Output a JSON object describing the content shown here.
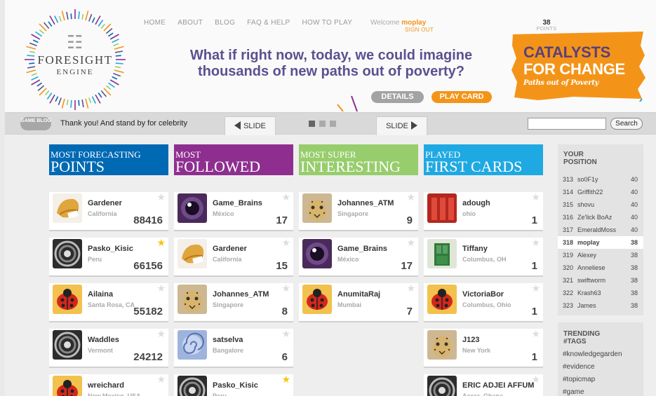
{
  "nav": {
    "items": [
      "HOME",
      "ABOUT",
      "BLOG",
      "FAQ & HELP",
      "HOW TO PLAY"
    ],
    "welcome_prefix": "Welcome",
    "username": "moplay",
    "signout": "SIGN OUT",
    "points_value": "38",
    "points_label": "POINTS"
  },
  "logo": {
    "line1": "FORESIGHT",
    "line2": "ENGINE"
  },
  "headline": {
    "line1": "What if right now, today, we could imagine",
    "line2": "thousands of new paths out of poverty?"
  },
  "banner": {
    "line1": "CATALYSTS",
    "line2": "FOR CHANGE",
    "line3": "Paths out of Poverty"
  },
  "buttons": {
    "details": "DETAILS",
    "play_card": "PLAY CARD"
  },
  "slidebar": {
    "game_blog": "GAME BLOG",
    "ticker": "Thank you! And stand by for celebrity",
    "prev": "SLIDE",
    "next": "SLIDE",
    "search_value": "",
    "search_button": "Search"
  },
  "columns": [
    {
      "title_small": "MOST FORECASTING",
      "title_big": "POINTS",
      "color": "#0069b4",
      "cards": [
        {
          "name": "Gardener",
          "loc": "California",
          "num": "88416",
          "avatar": "cookie",
          "star": false
        },
        {
          "name": "Pasko_Kisic",
          "loc": "Peru",
          "num": "66156",
          "avatar": "shell",
          "star": true
        },
        {
          "name": "Ailaina",
          "loc": "Santa Rosa, CA",
          "num": "55182",
          "avatar": "ladybug",
          "star": false
        },
        {
          "name": "Waddles",
          "loc": "Vermont",
          "num": "24212",
          "avatar": "shell",
          "star": false
        },
        {
          "name": "wreichard",
          "loc": "New Mexico, USA",
          "num": "",
          "avatar": "ladybug",
          "star": false
        }
      ]
    },
    {
      "title_small": "MOST",
      "title_big": "FOLLOWED",
      "color": "#8e2f90",
      "cards": [
        {
          "name": "Game_Brains",
          "loc": "México",
          "num": "17",
          "avatar": "eye",
          "star": false
        },
        {
          "name": "Gardener",
          "loc": "California",
          "num": "15",
          "avatar": "cookie",
          "star": false
        },
        {
          "name": "Johannes_ATM",
          "loc": "Singapore",
          "num": "8",
          "avatar": "cheetah",
          "star": false
        },
        {
          "name": "satselva",
          "loc": "Bangalore",
          "num": "6",
          "avatar": "swirl",
          "star": false
        },
        {
          "name": "Pasko_Kisic",
          "loc": "Peru",
          "num": "",
          "avatar": "shell",
          "star": true
        }
      ]
    },
    {
      "title_small": "MOST SUPER",
      "title_big": "INTERESTING",
      "color": "#97cd6c",
      "cards": [
        {
          "name": "Johannes_ATM",
          "loc": "Singapore",
          "num": "9",
          "avatar": "cheetah",
          "star": false
        },
        {
          "name": "Game_Brains",
          "loc": "México",
          "num": "17",
          "avatar": "eye",
          "star": false
        },
        {
          "name": "AnumitaRaj",
          "loc": "Mumbai",
          "num": "7",
          "avatar": "ladybug",
          "star": false
        }
      ]
    },
    {
      "title_small": "PLAYED",
      "title_big": "FIRST CARDS",
      "color": "#1fa9e2",
      "cards": [
        {
          "name": "adough",
          "loc": "ohio",
          "num": "1",
          "avatar": "redwall",
          "star": false
        },
        {
          "name": "Tiffany",
          "loc": "Columbus, OH",
          "num": "1",
          "avatar": "door",
          "star": false
        },
        {
          "name": "VictoriaBor",
          "loc": "Columbus, Ohio",
          "num": "1",
          "avatar": "ladybug",
          "star": false
        },
        {
          "name": "J123",
          "loc": "New York",
          "num": "1",
          "avatar": "cheetah",
          "star": false
        },
        {
          "name": "ERIC ADJEI AFFUM",
          "loc": "Accra, Ghana",
          "num": "",
          "avatar": "shell",
          "star": false
        }
      ]
    }
  ],
  "ranking": {
    "title_line1": "YOUR",
    "title_line2": "POSITION",
    "rows": [
      {
        "rank": "313",
        "name": "so0F1y",
        "points": "40"
      },
      {
        "rank": "314",
        "name": "Griffith22",
        "points": "40"
      },
      {
        "rank": "315",
        "name": "shovu",
        "points": "40"
      },
      {
        "rank": "316",
        "name": "Ze'lick BoAz",
        "points": "40"
      },
      {
        "rank": "317",
        "name": "EmeraldMoss",
        "points": "40"
      },
      {
        "rank": "318",
        "name": "moplay",
        "points": "38"
      },
      {
        "rank": "319",
        "name": "Alexey",
        "points": "38"
      },
      {
        "rank": "320",
        "name": "Anneliese",
        "points": "38"
      },
      {
        "rank": "321",
        "name": "swiftworm",
        "points": "38"
      },
      {
        "rank": "322",
        "name": "Krash63",
        "points": "38"
      },
      {
        "rank": "323",
        "name": "James",
        "points": "38"
      }
    ]
  },
  "trending": {
    "title_line1": "TRENDING",
    "title_line2": "#TAGS",
    "tags": [
      "#knowledgegarden",
      "#evidence",
      "#topicmap",
      "#game"
    ]
  }
}
